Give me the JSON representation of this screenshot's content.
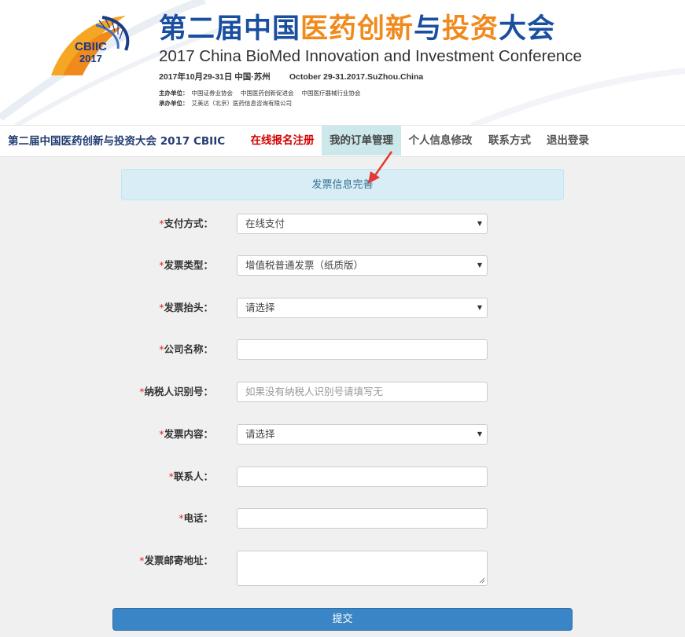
{
  "colors": {
    "brand_blue": "#1a4fa0",
    "brand_orange": "#f08a1c",
    "nav_active_bg": "#cde8ea",
    "nav_red": "#d40000",
    "notice_bg": "#d9edf7",
    "submit_bg": "#3a85c6",
    "required_star": "#d9262c"
  },
  "banner": {
    "logo_line1": "CBIIC",
    "logo_line2": "2017",
    "title_cn_part1": "第二届中国",
    "title_cn_part2": "医药创新",
    "title_cn_part3": "与",
    "title_cn_part4": "投资",
    "title_cn_part5": "大会",
    "title_en": "2017 China BioMed Innovation and Investment Conference",
    "date_cn": "2017年10月29-31日   中国·苏州",
    "date_en": "October 29-31.2017.SuZhou.China",
    "host_label": "主办单位：",
    "hosts": [
      "中国证券业协会",
      "中国医药创新促进会",
      "中国医疗器械行业协会"
    ],
    "organizer_label": "承办单位：",
    "organizer": "艾美达（北京）医药信息咨询有限公司"
  },
  "nav": {
    "brand": "第二届中国医药创新与投资大会 2017 CBIIC",
    "items": [
      "在线报名注册",
      "我的订单管理",
      "个人信息修改",
      "联系方式",
      "退出登录"
    ]
  },
  "notice": {
    "text": "发票信息完善"
  },
  "form": {
    "payment": {
      "label": "支付方式：",
      "value": "在线支付"
    },
    "invoice_type": {
      "label": "发票类型：",
      "value": "增值税普通发票（纸质版）"
    },
    "invoice_title": {
      "label": "发票抬头：",
      "value": "请选择"
    },
    "company": {
      "label": "公司名称：",
      "value": ""
    },
    "tax_id": {
      "label": "纳税人识别号：",
      "placeholder": "如果没有纳税人识别号请填写无"
    },
    "invoice_content": {
      "label": "发票内容：",
      "value": "请选择"
    },
    "contact": {
      "label": "联系人：",
      "value": ""
    },
    "phone": {
      "label": "电话：",
      "value": ""
    },
    "address": {
      "label": "发票邮寄地址：",
      "value": ""
    },
    "required_mark": "*",
    "submit_label": "提交"
  }
}
